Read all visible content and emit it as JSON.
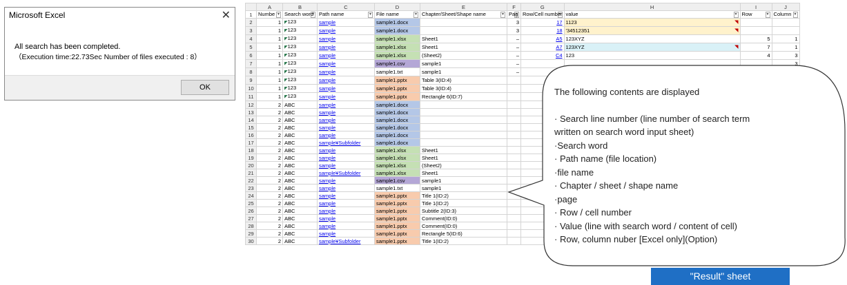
{
  "dialog": {
    "title": "Microsoft Excel",
    "close_glyph": "✕",
    "message": "All search has been completed.",
    "detail": "（Execution time:22.73Sec  Number of files executed : 8）",
    "ok_label": "OK"
  },
  "sheet": {
    "column_letters": [
      "",
      "A",
      "B",
      "C",
      "D",
      "E",
      "F",
      "G",
      "H",
      "I",
      "J"
    ],
    "header_row_number": "1",
    "headers": [
      "Numbe",
      "Search word",
      "Path name",
      "File name",
      "Chapter/Sheet/Shape name",
      "Pag",
      "Row/Cell number",
      "value",
      "Row",
      "Column"
    ],
    "filter_glyph": "▾",
    "rows": [
      {
        "n": "2",
        "a": "1",
        "b": "123",
        "c": "sample",
        "d": "sample1.docx",
        "d_type": "docx",
        "e": "",
        "f": "3",
        "g": "17",
        "h": "1123",
        "h_style": "yellow",
        "i": "",
        "j": ""
      },
      {
        "n": "3",
        "a": "1",
        "b": "123",
        "c": "sample",
        "d": "sample1.docx",
        "d_type": "docx",
        "e": "",
        "f": "3",
        "g": "18",
        "h": "'34512351",
        "h_style": "yellow",
        "i": "",
        "j": ""
      },
      {
        "n": "4",
        "a": "1",
        "b": "123",
        "c": "sample",
        "d": "sample1.xlsx",
        "d_type": "xlsx",
        "e": "Sheet1",
        "f": "–",
        "g": "A5",
        "h": "123XYZ",
        "h_style": "",
        "i": "5",
        "j": "1"
      },
      {
        "n": "5",
        "a": "1",
        "b": "123",
        "c": "sample",
        "d": "sample1.xlsx",
        "d_type": "xlsx",
        "e": "Sheet1",
        "f": "–",
        "g": "A7",
        "h": "123XYZ",
        "h_style": "cyan",
        "i": "7",
        "j": "1"
      },
      {
        "n": "6",
        "a": "1",
        "b": "123",
        "c": "sample",
        "d": "sample1.xlsx",
        "d_type": "xlsx",
        "e": "(Sheet2)",
        "f": "–",
        "g": "C4",
        "h": "123",
        "h_style": "",
        "i": "4",
        "j": "3"
      },
      {
        "n": "7",
        "a": "1",
        "b": "123",
        "c": "sample",
        "d": "sample1.csv",
        "d_type": "csv",
        "e": "sample1",
        "f": "–",
        "g": "",
        "h": "",
        "h_style": "",
        "i": "",
        "j": "3"
      },
      {
        "n": "8",
        "a": "1",
        "b": "123",
        "c": "sample",
        "d": "sample1.txt",
        "d_type": "txt",
        "e": "sample1",
        "f": "–",
        "g": "",
        "h": "",
        "h_style": "",
        "i": "",
        "j": ""
      },
      {
        "n": "9",
        "a": "1",
        "b": "123",
        "c": "sample",
        "d": "sample1.pptx",
        "d_type": "pptx",
        "e": "Table 3(ID:4)",
        "f": "",
        "g": "",
        "h": "",
        "h_style": "",
        "i": "",
        "j": ""
      },
      {
        "n": "10",
        "a": "1",
        "b": "123",
        "c": "sample",
        "d": "sample1.pptx",
        "d_type": "pptx",
        "e": "Table 3(ID:4)",
        "f": "",
        "g": "",
        "h": "",
        "h_style": "",
        "i": "",
        "j": ""
      },
      {
        "n": "11",
        "a": "1",
        "b": "123",
        "c": "sample",
        "d": "sample1.pptx",
        "d_type": "pptx",
        "e": "Rectangle 6(ID:7)",
        "f": "",
        "g": "",
        "h": "",
        "h_style": "",
        "i": "",
        "j": ""
      },
      {
        "n": "12",
        "a": "2",
        "b": "ABC",
        "c": "sample",
        "d": "sample1.docx",
        "d_type": "docx",
        "e": "",
        "f": "",
        "g": "",
        "h": "",
        "h_style": "",
        "i": "",
        "j": ""
      },
      {
        "n": "13",
        "a": "2",
        "b": "ABC",
        "c": "sample",
        "d": "sample1.docx",
        "d_type": "docx",
        "e": "",
        "f": "",
        "g": "",
        "h": "",
        "h_style": "",
        "i": "",
        "j": ""
      },
      {
        "n": "14",
        "a": "2",
        "b": "ABC",
        "c": "sample",
        "d": "sample1.docx",
        "d_type": "docx",
        "e": "",
        "f": "",
        "g": "",
        "h": "",
        "h_style": "",
        "i": "",
        "j": ""
      },
      {
        "n": "15",
        "a": "2",
        "b": "ABC",
        "c": "sample",
        "d": "sample1.docx",
        "d_type": "docx",
        "e": "",
        "f": "",
        "g": "",
        "h": "",
        "h_style": "",
        "i": "",
        "j": ""
      },
      {
        "n": "16",
        "a": "2",
        "b": "ABC",
        "c": "sample",
        "d": "sample1.docx",
        "d_type": "docx",
        "e": "",
        "f": "",
        "g": "",
        "h": "",
        "h_style": "",
        "i": "",
        "j": ""
      },
      {
        "n": "17",
        "a": "2",
        "b": "ABC",
        "c": "sample¥Subfolder",
        "d": "sample1.docx",
        "d_type": "docx",
        "e": "",
        "f": "",
        "g": "",
        "h": "",
        "h_style": "",
        "i": "",
        "j": ""
      },
      {
        "n": "18",
        "a": "2",
        "b": "ABC",
        "c": "sample",
        "d": "sample1.xlsx",
        "d_type": "xlsx",
        "e": "Sheet1",
        "f": "",
        "g": "",
        "h": "",
        "h_style": "",
        "i": "",
        "j": ""
      },
      {
        "n": "19",
        "a": "2",
        "b": "ABC",
        "c": "sample",
        "d": "sample1.xlsx",
        "d_type": "xlsx",
        "e": "Sheet1",
        "f": "",
        "g": "",
        "h": "",
        "h_style": "",
        "i": "",
        "j": ""
      },
      {
        "n": "20",
        "a": "2",
        "b": "ABC",
        "c": "sample",
        "d": "sample1.xlsx",
        "d_type": "xlsx",
        "e": "(Sheet2)",
        "f": "",
        "g": "",
        "h": "",
        "h_style": "",
        "i": "",
        "j": ""
      },
      {
        "n": "21",
        "a": "2",
        "b": "ABC",
        "c": "sample¥Subfolder",
        "d": "sample1.xlsx",
        "d_type": "xlsx",
        "e": "Sheet1",
        "f": "",
        "g": "",
        "h": "",
        "h_style": "",
        "i": "",
        "j": ""
      },
      {
        "n": "22",
        "a": "2",
        "b": "ABC",
        "c": "sample",
        "d": "sample1.csv",
        "d_type": "csv",
        "e": "sample1",
        "f": "",
        "g": "",
        "h": "",
        "h_style": "",
        "i": "",
        "j": ""
      },
      {
        "n": "23",
        "a": "2",
        "b": "ABC",
        "c": "sample",
        "d": "sample1.txt",
        "d_type": "txt",
        "e": "sample1",
        "f": "",
        "g": "",
        "h": "",
        "h_style": "",
        "i": "",
        "j": ""
      },
      {
        "n": "24",
        "a": "2",
        "b": "ABC",
        "c": "sample",
        "d": "sample1.pptx",
        "d_type": "pptx",
        "e": "Title 1(ID:2)",
        "f": "",
        "g": "",
        "h": "",
        "h_style": "",
        "i": "",
        "j": ""
      },
      {
        "n": "25",
        "a": "2",
        "b": "ABC",
        "c": "sample",
        "d": "sample1.pptx",
        "d_type": "pptx",
        "e": "Title 1(ID:2)",
        "f": "",
        "g": "",
        "h": "",
        "h_style": "",
        "i": "",
        "j": ""
      },
      {
        "n": "26",
        "a": "2",
        "b": "ABC",
        "c": "sample",
        "d": "sample1.pptx",
        "d_type": "pptx",
        "e": "Subtitle 2(ID:3)",
        "f": "",
        "g": "",
        "h": "",
        "h_style": "",
        "i": "",
        "j": ""
      },
      {
        "n": "27",
        "a": "2",
        "b": "ABC",
        "c": "sample",
        "d": "sample1.pptx",
        "d_type": "pptx",
        "e": "Comment(ID:0)",
        "f": "",
        "g": "",
        "h": "",
        "h_style": "",
        "i": "",
        "j": ""
      },
      {
        "n": "28",
        "a": "2",
        "b": "ABC",
        "c": "sample",
        "d": "sample1.pptx",
        "d_type": "pptx",
        "e": "Comment(ID:0)",
        "f": "",
        "g": "",
        "h": "",
        "h_style": "",
        "i": "",
        "j": ""
      },
      {
        "n": "29",
        "a": "2",
        "b": "ABC",
        "c": "sample",
        "d": "sample1.pptx",
        "d_type": "pptx",
        "e": "Rectangle 5(ID:6)",
        "f": "",
        "g": "",
        "h": "",
        "h_style": "",
        "i": "",
        "j": ""
      },
      {
        "n": "30",
        "a": "2",
        "b": "ABC",
        "c": "sample¥Subfolder",
        "d": "sample1.pptx",
        "d_type": "pptx",
        "e": "Title 1(ID:2)",
        "f": "",
        "g": "",
        "h": "",
        "h_style": "",
        "i": "",
        "j": ""
      }
    ]
  },
  "callout": {
    "heading": "The following contents are displayed",
    "items": [
      "· Search line number (line number of search term",
      "written on search word input sheet)",
      "·Search word",
      "· Path name (file location)",
      "·file name",
      "· Chapter / sheet / shape name",
      "·page",
      "· Row / cell number",
      "· Value (line with search word / content of cell)",
      "· Row, column nuber [Excel only](Option)"
    ]
  },
  "badge": {
    "label": "\"Result\" sheet",
    "color": "#1f6fc5"
  }
}
